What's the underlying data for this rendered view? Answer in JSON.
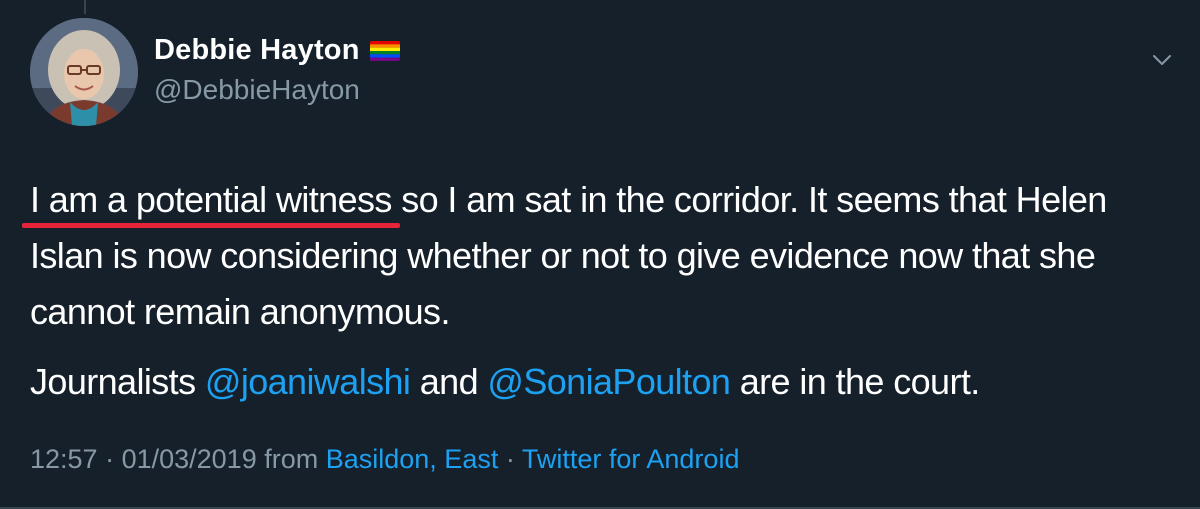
{
  "colors": {
    "background": "#15202b",
    "text_primary": "#ffffff",
    "text_secondary": "#8899a6",
    "link": "#1da1f2",
    "annotation_underline": "#e8243a"
  },
  "author": {
    "display_name": "Debbie Hayton",
    "name_emoji": "rainbow-flag-icon",
    "handle": "@DebbieHayton"
  },
  "tweet": {
    "highlighted_text": "I am a potential witness",
    "para1_rest": " so I am sat in the corridor. It seems that Helen Islan is now considering whether or not to give evidence now that she cannot remain anonymous.",
    "para2_prefix": "Journalists ",
    "mention1": "@joaniwalshi",
    "para2_middle": " and ",
    "mention2": "@SoniaPoulton",
    "para2_suffix": " are in the court."
  },
  "meta": {
    "time": "12:57",
    "separator1": " · ",
    "date": "01/03/2019",
    "from_label": " from ",
    "location": "Basildon, East",
    "separator2": " · ",
    "source": "Twitter for Android"
  },
  "icons": {
    "menu": "chevron-down-icon"
  }
}
